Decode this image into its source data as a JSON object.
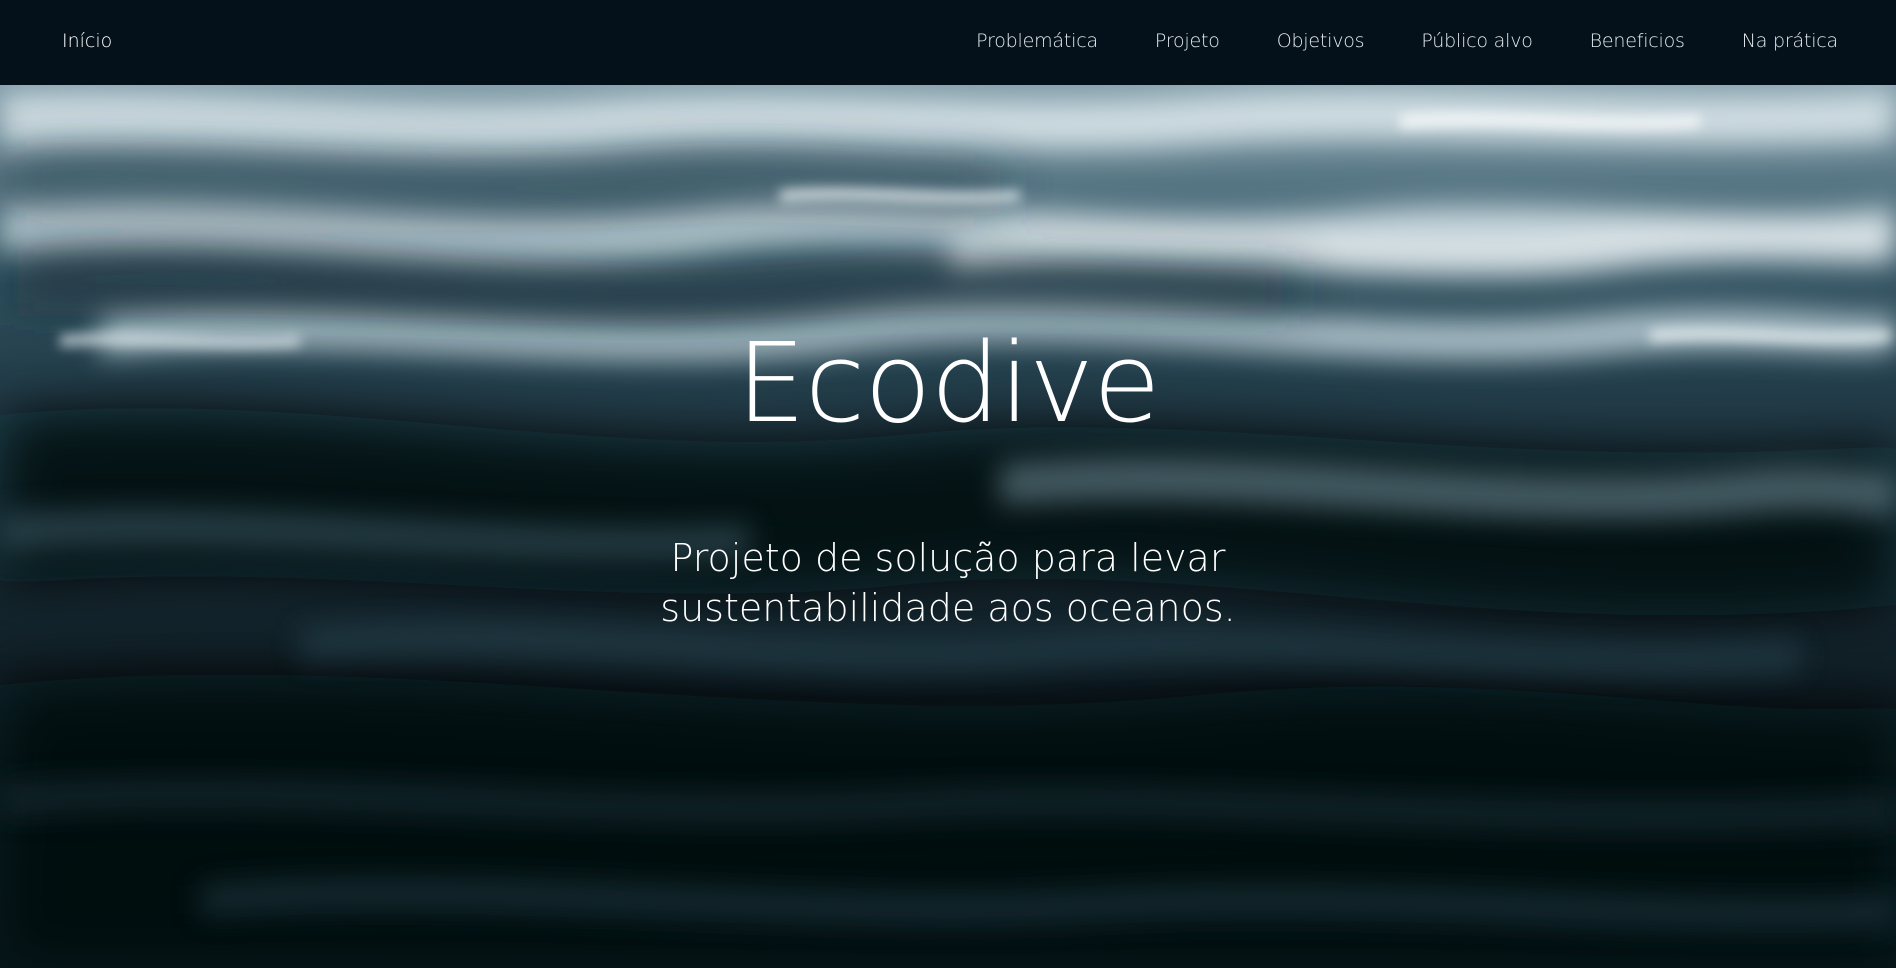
{
  "nav": {
    "home": "Início",
    "links": [
      "Problemática",
      "Projeto",
      "Objetivos",
      "Público alvo",
      "Beneficios",
      "Na prática"
    ]
  },
  "hero": {
    "title": "Ecodive",
    "subtitle_line1": "Projeto de solução para levar",
    "subtitle_line2": "sustentabilidade aos oceanos."
  },
  "colors": {
    "navbar_bg": "#04111a",
    "text": "#ffffff",
    "water_dark": "#03090d",
    "water_mid": "#2c4a58",
    "water_light": "#c7d6dc"
  },
  "icons": {
    "background": "ocean-water-image"
  }
}
